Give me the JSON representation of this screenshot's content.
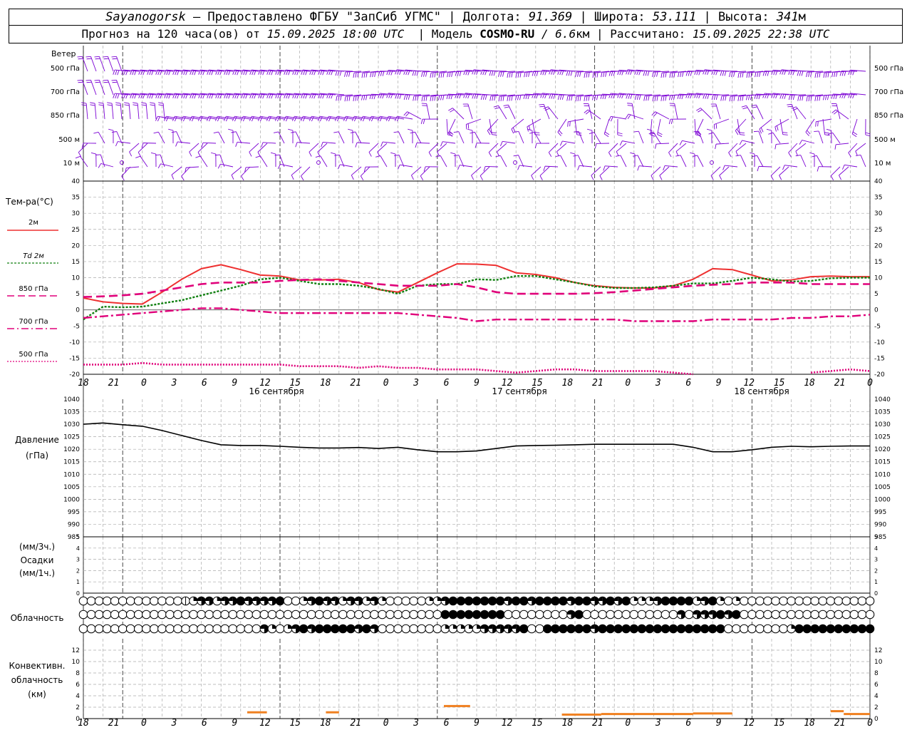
{
  "header": {
    "station": "Sayanogorsk",
    "provided_by": "— Предоставлено ФГБУ \"ЗапСиб УГМС\"",
    "lon_label": "Долгота:",
    "lon_value": "91.369",
    "lat_label": "Широта:",
    "lat_value": "53.111",
    "alt_label": "Высота:",
    "alt_value": "341",
    "alt_unit": "м",
    "forecast_label": "Прогноз на 120 часа(ов) от",
    "forecast_start": "15.09.2025 18:00 UTC",
    "model_label": "Модель",
    "model_name": "COSMO-RU",
    "model_res": "/ 6.6",
    "model_res_unit": "км",
    "calc_label": "Рассчитано:",
    "calc_time": "15.09.2025 22:38 UTC"
  },
  "wind_panel": {
    "title": "Ветер",
    "levels": [
      "500 гПа",
      "700 гПа",
      "850 гПа",
      "500 м",
      "10 м"
    ],
    "right_levels": [
      "500 гПа",
      "700 гПа",
      "850 гПа",
      "500 м",
      "10 м"
    ],
    "color": "#7b00d4"
  },
  "temp_panel": {
    "title": "Тем-ра(°C)",
    "legend": [
      {
        "label": "2м",
        "color": "#ee3030",
        "style": "solid"
      },
      {
        "label": "Td  2м",
        "color": "#108010",
        "style": "dotted"
      },
      {
        "label": "850 гПа",
        "color": "#e0007a",
        "style": "dash"
      },
      {
        "label": "700 гПа",
        "color": "#e0007a",
        "style": "dashdot"
      },
      {
        "label": "500 гПа",
        "color": "#e0007a",
        "style": "dot"
      }
    ]
  },
  "pressure_panel": {
    "title": "Давление",
    "unit": "(гПа)"
  },
  "precip_panel": {
    "unit_top": "(мм/3ч.)",
    "title": "Осадки",
    "unit_bottom": "(мм/1ч.)"
  },
  "cloud_panel": {
    "title": "Облачность"
  },
  "conv_panel": {
    "title_1": "Конвективн.",
    "title_2": "облачность",
    "unit": "(км)"
  },
  "time_axis": {
    "hours": [
      "18",
      "21",
      "0",
      "3",
      "6",
      "9",
      "12",
      "15",
      "18",
      "21",
      "0",
      "3",
      "6",
      "9",
      "12",
      "15",
      "18",
      "21",
      "0",
      "3",
      "6",
      "9",
      "12",
      "15",
      "18",
      "21",
      "0"
    ],
    "dates": [
      "16 сентября",
      "17 сентября",
      "18 сентября"
    ]
  },
  "chart_data": [
    {
      "type": "line",
      "title": "Тем-ра(°C)",
      "x_unit": "hours since 15.09.2025 18:00 UTC",
      "x": [
        0,
        3,
        6,
        9,
        12,
        15,
        18,
        21,
        24,
        27,
        30,
        33,
        36,
        39,
        42,
        45,
        48,
        51,
        54,
        57,
        60,
        63,
        66,
        69,
        72,
        75,
        78,
        81,
        84,
        87,
        90,
        93,
        96,
        99,
        102,
        105,
        108,
        111,
        114,
        117,
        120
      ],
      "ylim": [
        -20,
        40
      ],
      "yticks": [
        -20,
        -15,
        -10,
        -5,
        0,
        5,
        10,
        15,
        20,
        25,
        30,
        35,
        40
      ],
      "grid": true,
      "series": [
        {
          "name": "2м",
          "values": [
            3.7,
            2.5,
            2.0,
            1.8,
            5.5,
            9.5,
            12.8,
            14.0,
            12.5,
            10.8,
            10.5,
            9.3,
            9.3,
            9.5,
            8.5,
            6.3,
            5.5,
            8.5,
            11.5,
            14.3,
            14.2,
            13.8,
            11.5,
            11.0,
            10.0,
            8.5,
            7.5,
            7.0,
            6.8,
            6.8,
            7.5,
            9.5,
            12.8,
            12.5,
            10.8,
            9.0,
            9.3,
            10.3,
            10.5,
            10.3,
            10.3
          ],
          "color": "#ee3030"
        },
        {
          "name": "Td  2м",
          "values": [
            -3.0,
            1.0,
            0.8,
            1.0,
            2.0,
            3.0,
            4.5,
            6.0,
            7.5,
            9.5,
            10.0,
            9.0,
            8.0,
            8.0,
            7.5,
            6.5,
            5.0,
            7.5,
            8.0,
            8.0,
            9.5,
            9.3,
            10.5,
            10.5,
            9.5,
            8.5,
            7.3,
            6.8,
            6.8,
            7.0,
            7.5,
            8.2,
            8.2,
            9.0,
            10.0,
            9.5,
            8.8,
            9.0,
            9.8,
            10.0,
            10.0
          ],
          "color": "#108010"
        },
        {
          "name": "850 гПа",
          "values": [
            4.0,
            4.2,
            4.5,
            5.0,
            6.0,
            7.0,
            8.0,
            8.5,
            8.5,
            8.5,
            9.0,
            9.3,
            9.5,
            9.0,
            8.5,
            8.0,
            7.5,
            7.5,
            7.5,
            8.0,
            7.0,
            5.5,
            5.0,
            5.0,
            5.0,
            5.0,
            5.2,
            5.5,
            6.0,
            6.5,
            7.0,
            7.5,
            7.8,
            8.0,
            8.5,
            8.5,
            8.5,
            8.0,
            8.0,
            8.0,
            8.0
          ],
          "color": "#e0007a"
        },
        {
          "name": "700 гПа",
          "values": [
            -2.5,
            -2.0,
            -1.5,
            -1.0,
            -0.5,
            0.0,
            0.5,
            0.5,
            0.0,
            -0.5,
            -1.0,
            -1.0,
            -1.0,
            -1.0,
            -1.0,
            -1.0,
            -1.0,
            -1.5,
            -2.0,
            -2.5,
            -3.5,
            -3.0,
            -3.0,
            -3.0,
            -3.0,
            -3.0,
            -3.0,
            -3.0,
            -3.5,
            -3.5,
            -3.5,
            -3.5,
            -3.0,
            -3.0,
            -3.0,
            -3.0,
            -2.5,
            -2.5,
            -2.0,
            -2.0,
            -1.5
          ],
          "color": "#e0007a"
        },
        {
          "name": "500 гПа",
          "values": [
            -17.0,
            -17.0,
            -17.0,
            -16.5,
            -17.0,
            -17.0,
            -17.0,
            -17.0,
            -17.0,
            -17.0,
            -17.0,
            -17.5,
            -17.5,
            -17.5,
            -18.0,
            -17.5,
            -18.0,
            -18.0,
            -18.5,
            -18.5,
            -18.5,
            -19.0,
            -19.5,
            -19.0,
            -18.5,
            -18.5,
            -19.0,
            -19.0,
            -19.0,
            -19.0,
            -19.5,
            -20.0,
            null,
            null,
            null,
            null,
            null,
            -19.5,
            -19.0,
            -18.5,
            -19.0
          ],
          "color": "#e0007a"
        }
      ]
    },
    {
      "type": "line",
      "title": "Давление (гПа)",
      "x_unit": "hours since 15.09.2025 18:00 UTC",
      "x": [
        0,
        3,
        6,
        9,
        12,
        15,
        18,
        21,
        24,
        27,
        30,
        33,
        36,
        39,
        42,
        45,
        48,
        51,
        54,
        57,
        60,
        63,
        66,
        69,
        72,
        75,
        78,
        81,
        84,
        87,
        90,
        93,
        96,
        99,
        102,
        105,
        108,
        111,
        114,
        117,
        120
      ],
      "ylim": [
        985,
        1040
      ],
      "yticks": [
        985,
        990,
        995,
        1000,
        1005,
        1010,
        1015,
        1020,
        1025,
        1030,
        1035,
        1040
      ],
      "grid": true,
      "series": [
        {
          "name": "",
          "values": [
            1030.0,
            1030.5,
            1029.8,
            1029.2,
            1027.5,
            1025.5,
            1023.5,
            1021.8,
            1021.5,
            1021.5,
            1021.2,
            1020.8,
            1020.5,
            1020.5,
            1020.7,
            1020.3,
            1020.8,
            1019.8,
            1019.0,
            1019.0,
            1019.3,
            1020.3,
            1021.3,
            1021.5,
            1021.6,
            1021.8,
            1022.0,
            1022.0,
            1022.0,
            1022.0,
            1022.0,
            1020.8,
            1019.0,
            1019.0,
            1019.8,
            1020.8,
            1021.2,
            1021.0,
            1021.2,
            1021.3,
            1021.3
          ],
          "color": "#000000"
        }
      ]
    },
    {
      "type": "bar",
      "title": "Осадки",
      "ylim": [
        0,
        5
      ],
      "grid": true,
      "series": []
    },
    {
      "type": "table",
      "title": "Облачность",
      "x": [
        0,
        3,
        6,
        9,
        12,
        15,
        18,
        21,
        24,
        27,
        30,
        33,
        36,
        39,
        42,
        45,
        48,
        51,
        54,
        57,
        60,
        63,
        66,
        69,
        72,
        75,
        78,
        81,
        84,
        87,
        90,
        93,
        96,
        99,
        102,
        105,
        108,
        111,
        114,
        117,
        120
      ],
      "rows": [
        [
          0,
          0,
          0,
          0,
          0,
          0,
          0,
          0,
          0,
          0,
          0,
          0,
          0,
          1,
          2,
          3,
          3,
          2,
          3,
          3,
          4,
          3,
          3,
          3,
          3,
          4,
          0,
          0,
          2,
          3,
          4,
          3,
          3,
          2,
          3,
          3,
          2,
          3,
          2,
          0,
          0,
          0,
          0,
          0,
          2,
          2,
          3,
          4,
          4,
          4,
          4,
          4,
          4,
          4,
          3,
          4,
          4,
          3,
          4,
          4,
          4,
          4,
          3,
          4,
          4,
          3,
          3,
          4,
          3,
          4,
          2,
          2,
          2,
          3,
          4,
          4,
          4,
          4,
          2,
          3,
          4,
          2,
          0,
          2,
          0,
          0,
          0,
          0,
          0,
          0,
          0,
          0,
          0,
          0,
          0,
          0,
          0,
          0,
          0,
          0,
          0
        ],
        [
          0,
          0,
          0,
          0,
          0,
          0,
          0,
          0,
          0,
          0,
          0,
          0,
          0,
          0,
          0,
          0,
          0,
          0,
          0,
          0,
          0,
          0,
          0,
          0,
          0,
          0,
          0,
          0,
          0,
          0,
          0,
          0,
          0,
          0,
          0,
          0,
          0,
          0,
          0,
          0,
          0,
          0,
          0,
          0,
          0,
          0,
          4,
          4,
          4,
          4,
          4,
          4,
          4,
          4,
          0,
          0,
          0,
          0,
          0,
          0,
          0,
          0,
          3,
          4,
          0,
          0,
          0,
          0,
          0,
          0,
          0,
          0,
          0,
          0,
          0,
          0,
          3,
          0,
          3,
          3,
          3,
          4,
          3,
          4,
          0,
          0,
          0,
          0,
          0,
          0,
          0,
          0,
          0,
          0,
          0,
          0,
          0,
          0,
          0,
          0,
          0
        ],
        [
          0,
          0,
          0,
          0,
          0,
          0,
          0,
          0,
          0,
          0,
          0,
          0,
          0,
          0,
          0,
          0,
          0,
          0,
          0,
          0,
          0,
          0,
          0,
          3,
          2,
          0,
          2,
          3,
          4,
          3,
          4,
          4,
          4,
          4,
          4,
          3,
          4,
          3,
          0,
          0,
          0,
          0,
          0,
          0,
          0,
          0,
          2,
          2,
          2,
          2,
          2,
          3,
          3,
          3,
          3,
          3,
          4,
          0,
          0,
          4,
          4,
          4,
          4,
          4,
          4,
          3,
          4,
          4,
          4,
          4,
          4,
          4,
          4,
          4,
          4,
          4,
          4,
          4,
          4,
          4,
          4,
          4,
          0,
          0,
          0,
          0,
          0,
          0,
          0,
          0,
          2,
          4,
          4,
          4,
          4,
          4,
          4,
          4,
          4,
          4,
          4
        ]
      ]
    },
    {
      "type": "bar",
      "title": "Конвективн. облачность (км)",
      "x_unit": "hours since 15.09.2025 18:00 UTC",
      "ylim": [
        0,
        13
      ],
      "yticks": [
        0,
        2,
        4,
        6,
        8,
        10,
        12
      ],
      "grid": true,
      "segments": [
        {
          "x_start": 25,
          "x_end": 28,
          "top_km": 1.1
        },
        {
          "x_start": 37,
          "x_end": 39,
          "top_km": 1.1
        },
        {
          "x_start": 55,
          "x_end": 59,
          "top_km": 2.2
        },
        {
          "x_start": 73,
          "x_end": 79,
          "top_km": 0.7
        },
        {
          "x_start": 79,
          "x_end": 93,
          "top_km": 0.8
        },
        {
          "x_start": 93,
          "x_end": 99,
          "top_km": 0.9
        },
        {
          "x_start": 114,
          "x_end": 116,
          "top_km": 1.3
        },
        {
          "x_start": 116,
          "x_end": 120,
          "top_km": 0.8
        }
      ]
    }
  ]
}
